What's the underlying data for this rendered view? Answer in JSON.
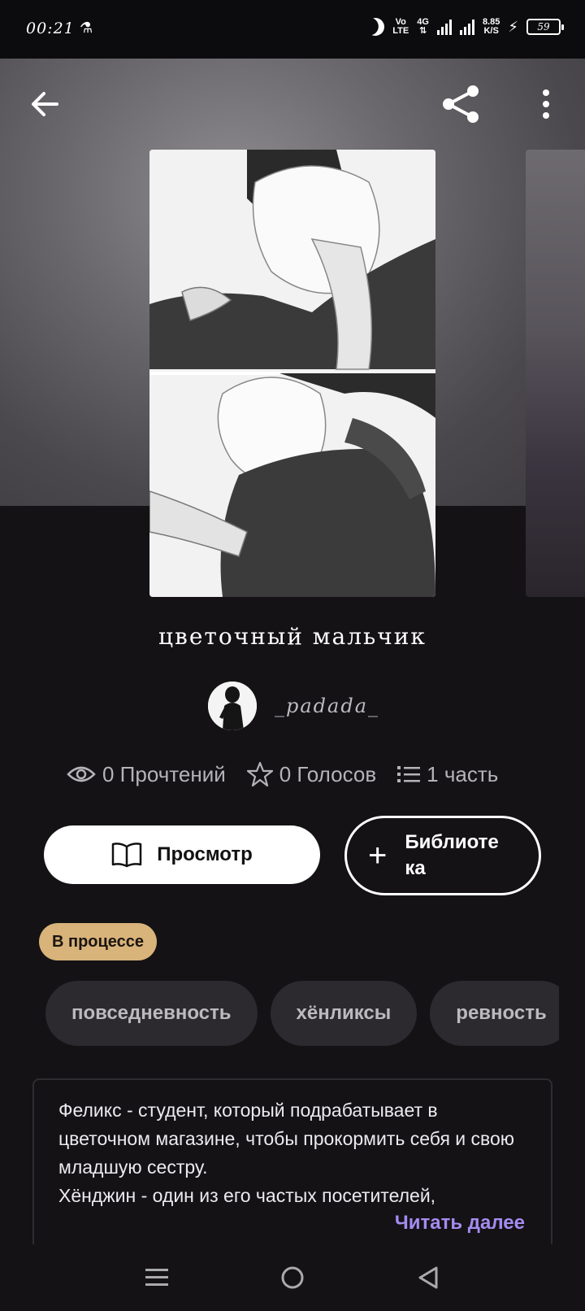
{
  "status_bar": {
    "time": "00:21",
    "lab_icon": "⚗",
    "network_top": "Vo",
    "network_bottom": "LTE",
    "net_type": "4G",
    "speed_value": "8.85",
    "speed_unit": "K/S",
    "battery": "59"
  },
  "top_nav": {
    "back_icon": "arrow-left-icon",
    "share_icon": "share-icon",
    "more_icon": "more-vertical-icon"
  },
  "story": {
    "title": "цветочный мальчик",
    "author": "_padada_"
  },
  "stats": {
    "reads": "0 Прочтений",
    "votes": "0 Голосов",
    "parts": "1 часть"
  },
  "actions": {
    "read_label": "Просмотр",
    "library_label_line1": "Библиоте",
    "library_label_line2": "ка"
  },
  "status_badge": "В процессе",
  "tags": [
    "повседневность",
    "хёнликсы",
    "ревность"
  ],
  "description": {
    "text": "Феликс - студент, который подрабатывает в цветочном магазине, чтобы прокормить себя и свою младшую сестру.\nХёнджин - один из его частых посетителей,",
    "read_more": "Читать далее"
  },
  "system_nav": {
    "menu_icon": "menu-icon",
    "home_icon": "home-circle-icon",
    "back_icon": "back-triangle-icon"
  },
  "colors": {
    "background": "#141215",
    "accent_read_more": "#a58bf0",
    "badge": "#d8b37a",
    "tag_bg": "#2c2a2e"
  }
}
